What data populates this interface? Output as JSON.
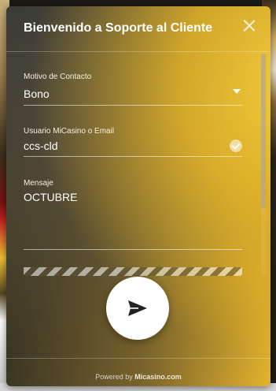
{
  "widget": {
    "title": "Bienvenido a Soporte al Cliente",
    "close_icon": "close-icon"
  },
  "form": {
    "contact_reason": {
      "label": "Motivo de Contacto",
      "value": "Bono",
      "icon": "chevron-down-icon"
    },
    "user": {
      "label": "Usuario MiCasino o Email",
      "value": "ccs-cld",
      "icon": "check-circle-icon"
    },
    "message": {
      "label": "Mensaje",
      "value": "OCTUBRE"
    }
  },
  "send_button": {
    "icon": "send-icon"
  },
  "footer": {
    "powered_by": "Powered by",
    "brand": "Micasino.com"
  },
  "colors": {
    "accent_gold": "#e3b12c",
    "dark": "#3a3a36",
    "text": "#ffffff"
  }
}
